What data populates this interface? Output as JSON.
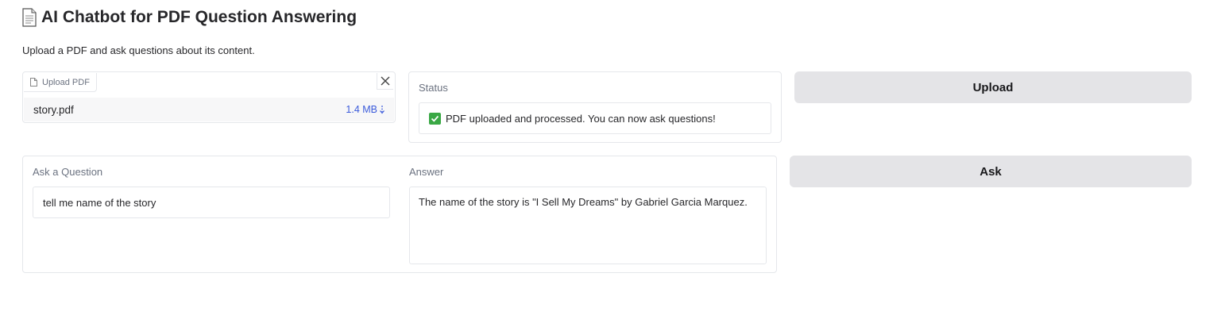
{
  "header": {
    "title": "AI Chatbot for PDF Question Answering",
    "subtitle": "Upload a PDF and ask questions about its content."
  },
  "upload": {
    "tab_label": "Upload PDF",
    "file_name": "story.pdf",
    "file_size": "1.4 MB",
    "button_label": "Upload"
  },
  "status": {
    "label": "Status",
    "message": "PDF uploaded and processed. You can now ask questions!"
  },
  "qa": {
    "question_label": "Ask a Question",
    "question_value": "tell me name of the story",
    "answer_label": "Answer",
    "answer_value": "The name of the story is \"I Sell My Dreams\" by Gabriel Garcia Marquez.",
    "ask_button_label": "Ask"
  },
  "icons": {
    "title_icon": "document-icon",
    "file_tab_icon": "file-icon",
    "close_icon": "close-icon",
    "download_icon": "download-icon",
    "status_icon": "check-mark-icon"
  },
  "colors": {
    "accent_link": "#3b5bdb",
    "button_bg": "#e4e4e7",
    "check_green": "#3aa845"
  }
}
